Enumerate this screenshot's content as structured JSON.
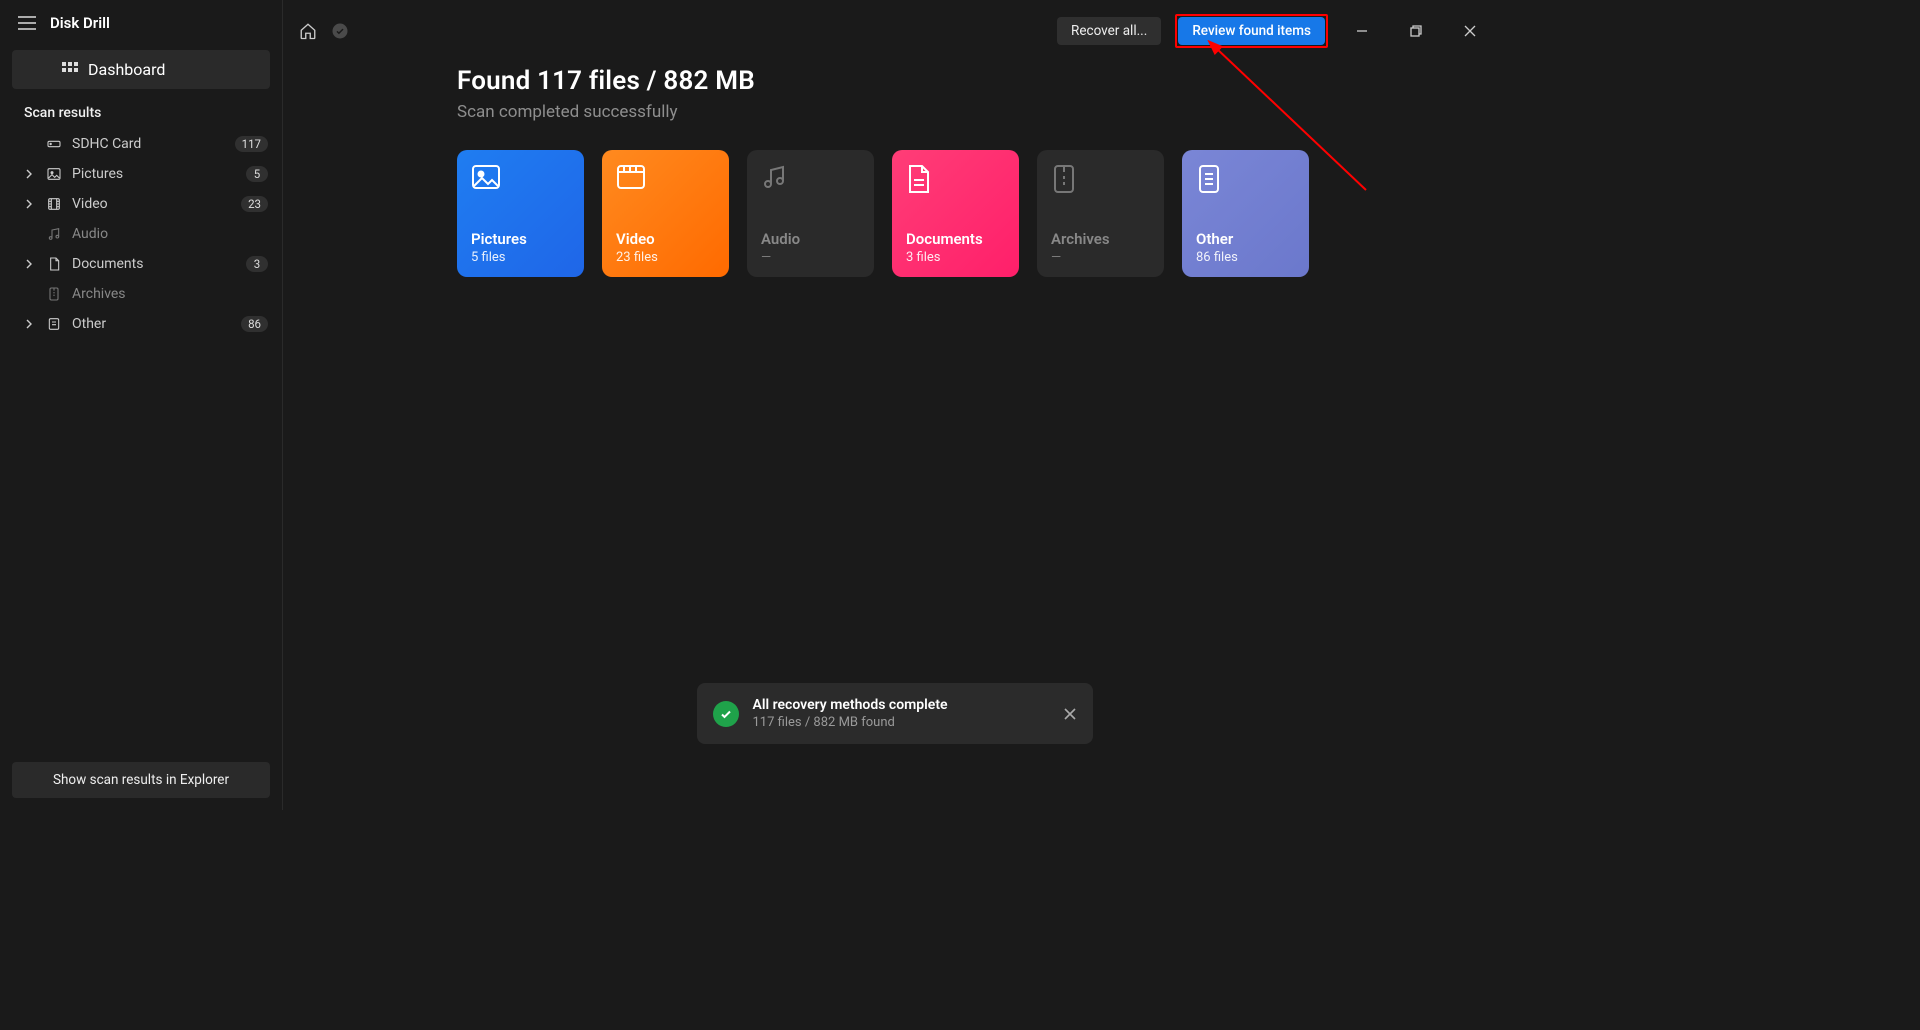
{
  "app": {
    "title": "Disk Drill"
  },
  "sidebar": {
    "dashboard": "Dashboard",
    "section": "Scan results",
    "items": [
      {
        "label": "SDHC Card",
        "count": "117",
        "expandable": false,
        "muted": false,
        "icon": "drive"
      },
      {
        "label": "Pictures",
        "count": "5",
        "expandable": true,
        "muted": false,
        "icon": "image"
      },
      {
        "label": "Video",
        "count": "23",
        "expandable": true,
        "muted": false,
        "icon": "film"
      },
      {
        "label": "Audio",
        "count": "",
        "expandable": false,
        "muted": true,
        "icon": "note"
      },
      {
        "label": "Documents",
        "count": "3",
        "expandable": true,
        "muted": false,
        "icon": "doc"
      },
      {
        "label": "Archives",
        "count": "",
        "expandable": false,
        "muted": true,
        "icon": "zip"
      },
      {
        "label": "Other",
        "count": "86",
        "expandable": true,
        "muted": false,
        "icon": "other"
      }
    ],
    "footer_btn": "Show scan results in Explorer"
  },
  "topbar": {
    "recover_all": "Recover all...",
    "review": "Review found items"
  },
  "results": {
    "headline": "Found 117 files / 882 MB",
    "subhead": "Scan completed successfully",
    "cards": [
      {
        "title": "Pictures",
        "sub": "5 files",
        "style": "pictures"
      },
      {
        "title": "Video",
        "sub": "23 files",
        "style": "video"
      },
      {
        "title": "Audio",
        "sub": "—",
        "style": "audio"
      },
      {
        "title": "Documents",
        "sub": "3 files",
        "style": "documents"
      },
      {
        "title": "Archives",
        "sub": "—",
        "style": "archives"
      },
      {
        "title": "Other",
        "sub": "86 files",
        "style": "other"
      }
    ]
  },
  "toast": {
    "title": "All recovery methods complete",
    "sub": "117 files / 882 MB found"
  }
}
